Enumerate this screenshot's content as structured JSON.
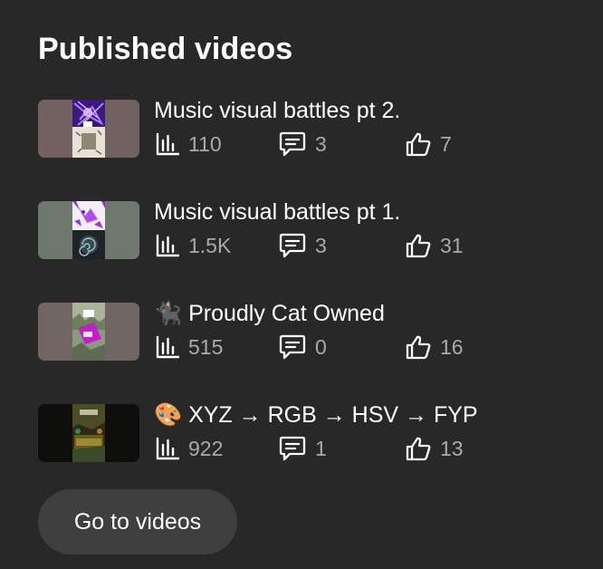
{
  "section": {
    "title": "Published videos"
  },
  "videos": [
    {
      "title": "Music visual battles pt 2.",
      "views": "110",
      "comments": "3",
      "likes": "7",
      "thumb_icon": "thumbnail-purple-neon"
    },
    {
      "title": "Music visual battles pt 1.",
      "views": "1.5K",
      "comments": "3",
      "likes": "31",
      "thumb_icon": "thumbnail-purple-spiral"
    },
    {
      "title": "🐈‍⬛ Proudly Cat Owned",
      "views": "515",
      "comments": "0",
      "likes": "16",
      "thumb_icon": "thumbnail-cat-sign"
    },
    {
      "title": "🎨 XYZ → RGB → HSV → FYP",
      "views": "922",
      "comments": "1",
      "likes": "13",
      "thumb_icon": "thumbnail-colorful-scene"
    }
  ],
  "actions": {
    "go_to_videos": "Go to videos"
  },
  "colors": {
    "background": "#282828",
    "text_primary": "#ffffff",
    "text_secondary": "#aaaaaa",
    "button_bg": "#3f3f3f"
  }
}
